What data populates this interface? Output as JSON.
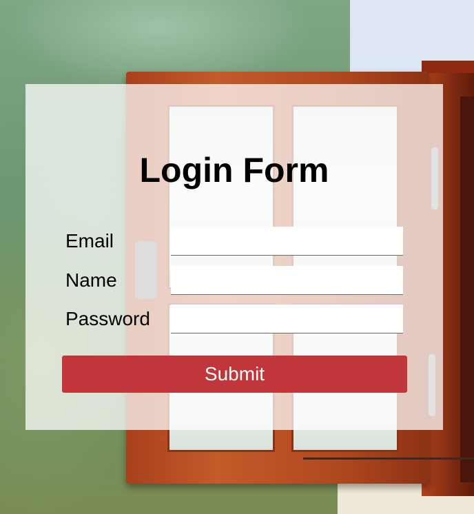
{
  "form": {
    "title": "Login Form",
    "fields": [
      {
        "label": "Email",
        "value": "",
        "placeholder": ""
      },
      {
        "label": "Name",
        "value": "",
        "placeholder": ""
      },
      {
        "label": "Password",
        "value": "",
        "placeholder": ""
      }
    ],
    "submit_label": "Submit"
  },
  "colors": {
    "submit_button": "#c1363b",
    "card_background": "rgba(255,255,255,0.74)"
  }
}
